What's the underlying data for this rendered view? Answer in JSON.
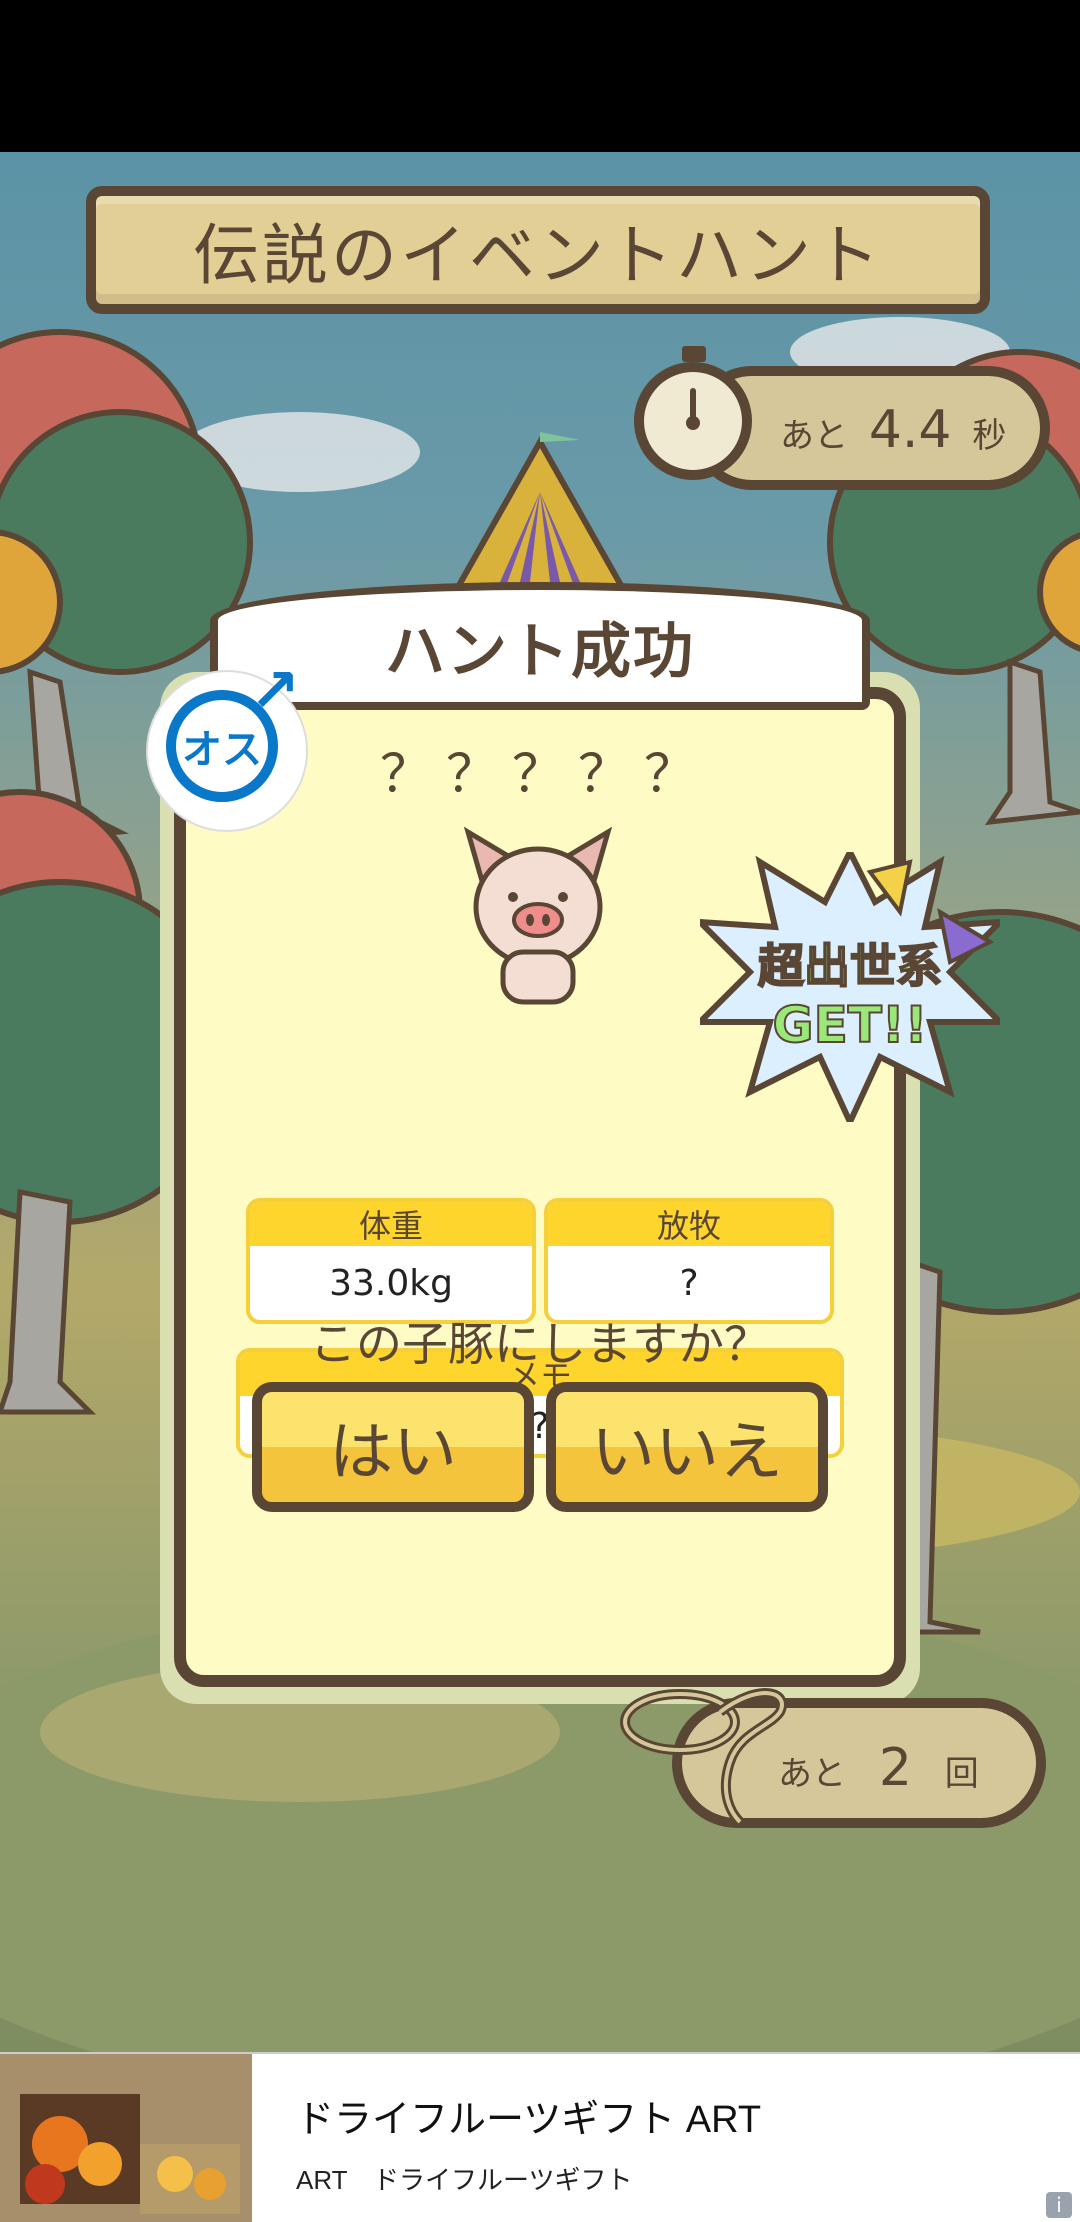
{
  "header": {
    "title": "伝説のイベントハント"
  },
  "timer": {
    "prefix": "あと",
    "value": "4.4",
    "unit": "秒"
  },
  "result": {
    "banner": "ハント成功",
    "gender_label": "オス",
    "pig_name": "？？？？？",
    "starburst_line1": "超出世系",
    "starburst_line2": "GET!!",
    "stats": {
      "weight_label": "体重",
      "weight_value": "33.0kg",
      "grazing_label": "放牧",
      "grazing_value": "?",
      "memo_label": "メモ",
      "memo_value": "???"
    },
    "question": "この子豚にしますか？",
    "yes_label": "はい",
    "no_label": "いいえ"
  },
  "attempts": {
    "prefix": "あと",
    "value": "2",
    "unit": "回"
  },
  "ad": {
    "title": "ドライフルーツギフト ART",
    "subtitle": "ART　ドライフルーツギフト",
    "info_icon": "i"
  },
  "icons": [
    "stopwatch-icon",
    "male-icon",
    "pig-icon",
    "rope-icon",
    "info-icon"
  ],
  "colors": {
    "accent_yellow": "#fdd52d",
    "outline_brown": "#5a4634",
    "male_blue": "#0a78c8",
    "burst_green": "#9be87a"
  }
}
